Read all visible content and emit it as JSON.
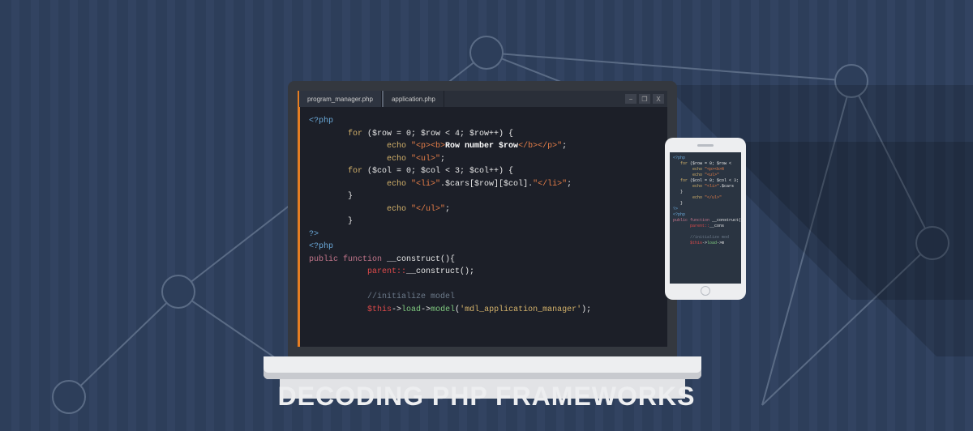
{
  "title": "DECODING PHP FRAMEWORKS",
  "tabs": {
    "active": "program_manager.php",
    "other": "application.php"
  },
  "window_controls": {
    "min": "−",
    "max": "❐",
    "close": "X"
  },
  "code": {
    "l1_open": "<?php",
    "l2_for": "for",
    "l2_rest": " ($row = 0; $row < 4; $row++) {",
    "l3_echo": "echo ",
    "l3_s1": "\"<p><b>",
    "l3_txt": "Row number $row",
    "l3_s2": "</b></p>\"",
    "l3_semi": ";",
    "l4_echo": "echo ",
    "l4_str": "\"<ul>\"",
    "l4_semi": ";",
    "l5_for": "for",
    "l5_rest": " ($col = 0; $col < 3; $col++) {",
    "l6_echo": "echo ",
    "l6_s1": "\"<li>\"",
    "l6_mid": ".$cars[$row][$col].",
    "l6_s2": "\"</li>\"",
    "l6_semi": ";",
    "l7_brace": "}",
    "l8_echo": "echo ",
    "l8_str": "\"</ul>\"",
    "l8_semi": ";",
    "l9_brace": "}",
    "l10_close": "?>",
    "l11_open": "<?php",
    "l12_pub": "public function ",
    "l12_fn": "__construct",
    "l12_paren": "(){",
    "l13_parent": "parent::",
    "l13_fn": "__construct",
    "l13_end": "();",
    "l14_empty": "",
    "l15_com": "//initialize model",
    "l16_this": "$this",
    "l16_arrow1": "->",
    "l16_load": "load",
    "l16_arrow2": "->",
    "l16_model": "model",
    "l16_paren": "(",
    "l16_str": "'mdl_application_manager'",
    "l16_end": ");"
  },
  "phone_code": {
    "l1": "<?php",
    "l2a": "for",
    "l2b": " ($row = 0; $row <",
    "l3a": "echo ",
    "l3b": "\"<p><b>R",
    "l4a": "echo ",
    "l4b": "\"<ul>\"",
    "l5a": "for",
    "l5b": " ($col = 0; $col < 3;",
    "l6a": "echo ",
    "l6b": "\"<li>\"",
    "l6c": ".$cars",
    "l7": "}",
    "l8a": "echo ",
    "l8b": "\"</ul>\"",
    "l9": "}",
    "l10": "?>",
    "l11": "<?php",
    "l12a": "public function ",
    "l12b": "__construct",
    "l12c": "(){",
    "l13a": "parent::",
    "l13b": "__cons",
    "l14": "//initialize mod",
    "l15a": "$this",
    "l15b": "->",
    "l15c": "load",
    "l15d": "->m"
  }
}
